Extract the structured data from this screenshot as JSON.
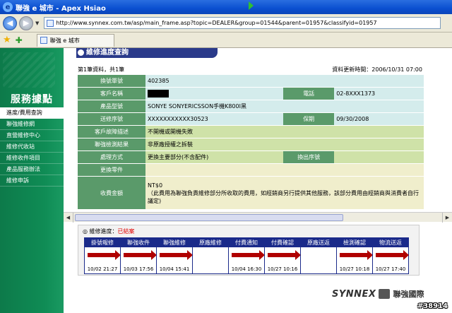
{
  "window": {
    "title": "聯強 e 城市 - Apex Hsiao"
  },
  "address": {
    "url": "http://www.synnex.com.tw/asp/main_frame.asp?topic=DEALER&group=01544&parent=01957&classifyid=01957"
  },
  "tab": {
    "label": "聯強 e 城市"
  },
  "sidebar": {
    "title": "服務據點",
    "items": [
      {
        "label": "進度/費用查詢"
      },
      {
        "label": "聯強維修網"
      },
      {
        "label": "直營維修中心"
      },
      {
        "label": "維修代收站"
      },
      {
        "label": "維修收件項目"
      },
      {
        "label": "產品服務辦法"
      },
      {
        "label": "維修申訴"
      }
    ]
  },
  "page": {
    "header": "維修進度查詢",
    "record_count": "第1筆資料，共1筆",
    "update_time": "資料更新時間：2006/10/31 07:00"
  },
  "info": {
    "receipt_no_label": "換號單號",
    "receipt_no": "402385",
    "customer_label": "客戶名稱",
    "phone_label": "電話",
    "phone": "02-8XXX1373",
    "model_label": "產品型號",
    "model": "SONYE SONYERICSSON手機K800I黑",
    "serial_label": "送修序號",
    "serial": "XXXXXXXXXXX30523",
    "warranty_label": "保期",
    "warranty": "09/30/2008",
    "symptom_label": "客戶故障描述",
    "symptom": "不開機或開機失敗",
    "result_label": "聯強檢測結果",
    "result": "非原廠授權之拆裝",
    "method_label": "處理方式",
    "method": "更換主要部分(不含配件)",
    "swap_serial_label": "換出序號",
    "parts_label": "更換零件",
    "fee_label": "收費金額",
    "fee_amount": "NT$0",
    "fee_note": "（此費用為聯強負責維修部分所收取的費用，如經銷商另行提供其他服務，該部分費用由經銷商與消費者自行議定)"
  },
  "progress": {
    "title": "◎ 維修進度：",
    "status": "已結案",
    "steps": [
      {
        "label": "掛號報修",
        "date": "10/02 21:27"
      },
      {
        "label": "聯強收件",
        "date": "10/03 17:56"
      },
      {
        "label": "聯強維修",
        "date": "10/04 15:41"
      },
      {
        "label": "原廠維修",
        "date": ""
      },
      {
        "label": "付費通知",
        "date": "10/04 16:30"
      },
      {
        "label": "付費確認",
        "date": "10/27 10:16"
      },
      {
        "label": "原廠送返",
        "date": ""
      },
      {
        "label": "檢測確認",
        "date": "10/27 10:18"
      },
      {
        "label": "物流送返",
        "date": "10/27 17:40"
      }
    ]
  },
  "footer": {
    "brand": "SYNNEX",
    "brand_cn": "聯強國際",
    "watermark": "#38914"
  }
}
